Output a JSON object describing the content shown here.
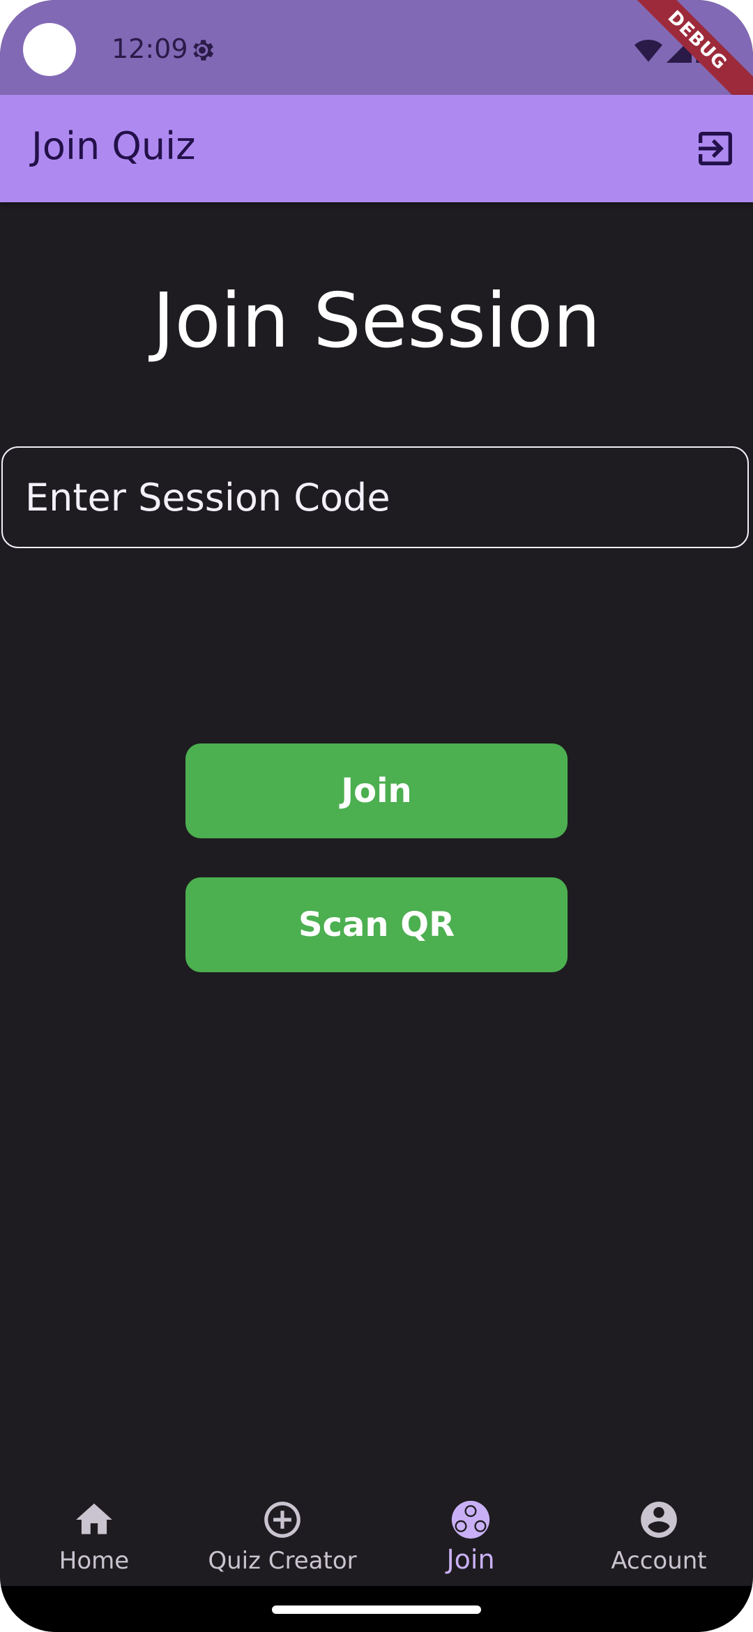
{
  "status_bar": {
    "time": "12:09",
    "debug_label": "DEBUG"
  },
  "app_bar": {
    "title": "Join Quiz"
  },
  "main": {
    "heading": "Join Session",
    "session_input": {
      "placeholder": "Enter Session Code",
      "value": ""
    },
    "join_button": "Join",
    "scan_button": "Scan QR"
  },
  "bottom_nav": {
    "items": [
      {
        "label": "Home",
        "icon": "home-icon",
        "active": false
      },
      {
        "label": "Quiz Creator",
        "icon": "add-circle-icon",
        "active": false
      },
      {
        "label": "Join",
        "icon": "group-icon",
        "active": true
      },
      {
        "label": "Account",
        "icon": "account-icon",
        "active": false
      }
    ]
  },
  "colors": {
    "status_bar": "#8269b5",
    "app_bar": "#ae8af0",
    "background": "#1e1c20",
    "button": "#4caf50",
    "nav_active": "#c9b0f6",
    "nav_inactive": "#cac4d0"
  }
}
